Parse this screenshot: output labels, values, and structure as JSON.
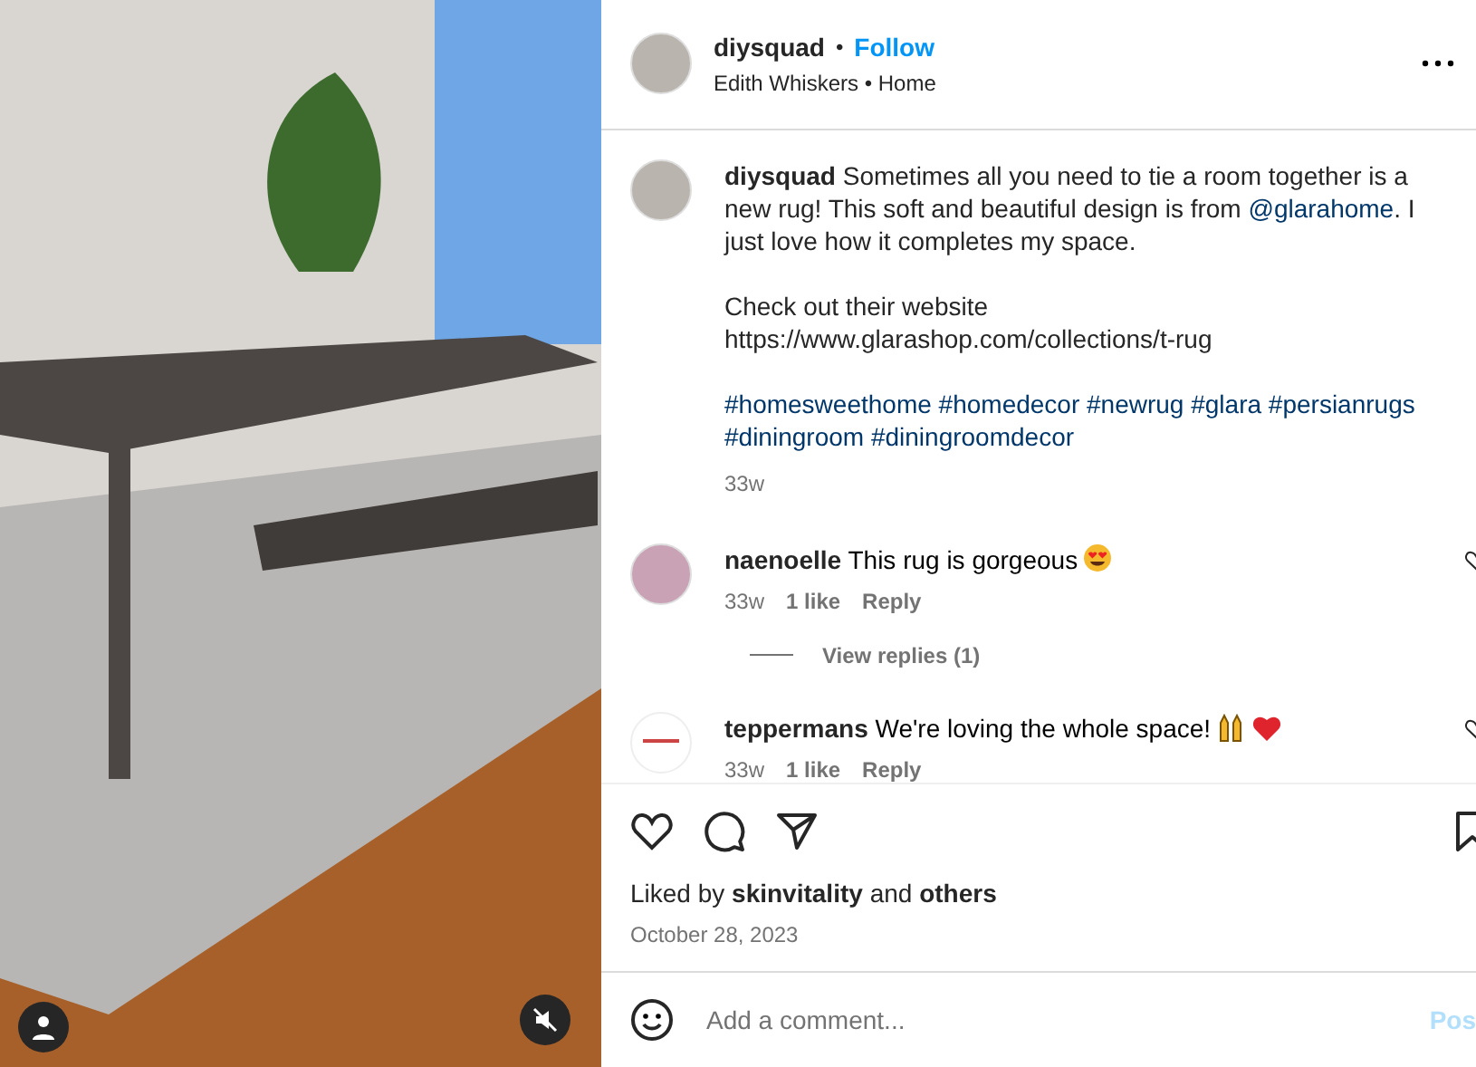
{
  "post": {
    "username": "diysquad",
    "separator": "•",
    "follow": "Follow",
    "subtitle": "Edith Whiskers • Home"
  },
  "caption": {
    "username": "diysquad",
    "text_before": "Sometimes all you need to tie a room together is a new rug! This soft and beautiful design is from ",
    "mention": "@glarahome",
    "text_after": ". I just love how it completes my space.",
    "line2": "Check out their website",
    "url": "https://www.glarashop.com/collections/t-rug",
    "hashtags": [
      "#homesweethome",
      "#homedecor",
      "#newrug",
      "#glara",
      "#persianrugs",
      "#diningroom",
      "#diningroomdecor"
    ],
    "time": "33w"
  },
  "comments": [
    {
      "username": "naenoelle",
      "text": "This rug is gorgeous",
      "emojis": [
        {
          "kind": "heart-eyes"
        }
      ],
      "time": "33w",
      "likes": "1 like",
      "reply": "Reply",
      "view_replies": "View replies (1)",
      "avatar": {
        "kind": "photo"
      }
    },
    {
      "username": "teppermans",
      "text": "We're loving the whole space!",
      "emojis": [
        {
          "kind": "raised-hands"
        },
        {
          "kind": "heart"
        }
      ],
      "time": "33w",
      "likes": "1 like",
      "reply": "Reply",
      "avatar": {
        "kind": "logo"
      }
    }
  ],
  "likes": {
    "prefix": "Liked by",
    "user": "skinvitality",
    "middle": "and",
    "others": "others"
  },
  "date": "October 28, 2023",
  "comment_box": {
    "placeholder": "Add a comment...",
    "post": "Pos"
  }
}
